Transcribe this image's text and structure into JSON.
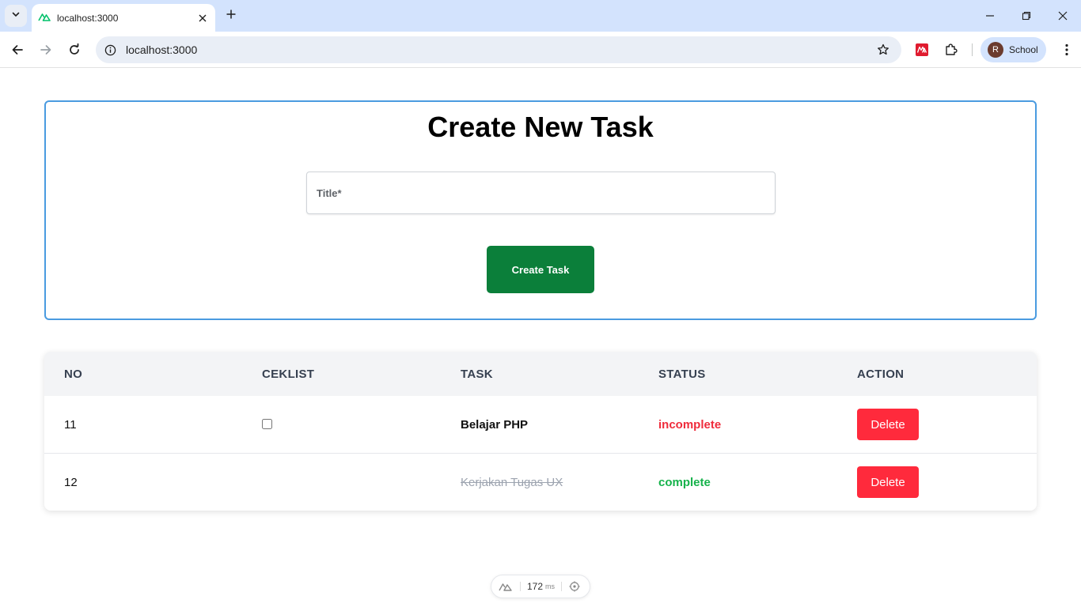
{
  "browser": {
    "tab_title": "localhost:3000",
    "url": "localhost:3000",
    "profile_initial": "R",
    "profile_name": "School",
    "icons": [
      "chevron-down-icon",
      "nuxt-icon",
      "close-icon",
      "plus-icon",
      "minimize-icon",
      "restore-icon",
      "back-icon",
      "forward-icon",
      "reload-icon",
      "info-icon",
      "star-icon",
      "extension-icon",
      "puzzle-icon",
      "more-icon"
    ]
  },
  "create_form": {
    "heading": "Create New Task",
    "title_placeholder": "Title*",
    "title_value": "",
    "submit_label": "Create Task"
  },
  "table": {
    "headers": {
      "no": "NO",
      "checklist": "CEKLIST",
      "task": "TASK",
      "status": "STATUS",
      "action": "ACTION"
    },
    "rows": [
      {
        "no": "11",
        "checked": false,
        "show_checkbox": true,
        "task": "Belajar PHP",
        "status": "incomplete",
        "action": "Delete"
      },
      {
        "no": "12",
        "checked": true,
        "show_checkbox": false,
        "task": "Kerjakan Tugas UX",
        "status": "complete",
        "action": "Delete"
      }
    ]
  },
  "devtools": {
    "time": "172",
    "unit": "ms"
  },
  "colors": {
    "accent_border": "#4a9be0",
    "create_button": "#0b7f3a",
    "delete_button": "#ff2a3c",
    "status_incomplete": "#ef2b3b",
    "status_complete": "#16b24b"
  }
}
